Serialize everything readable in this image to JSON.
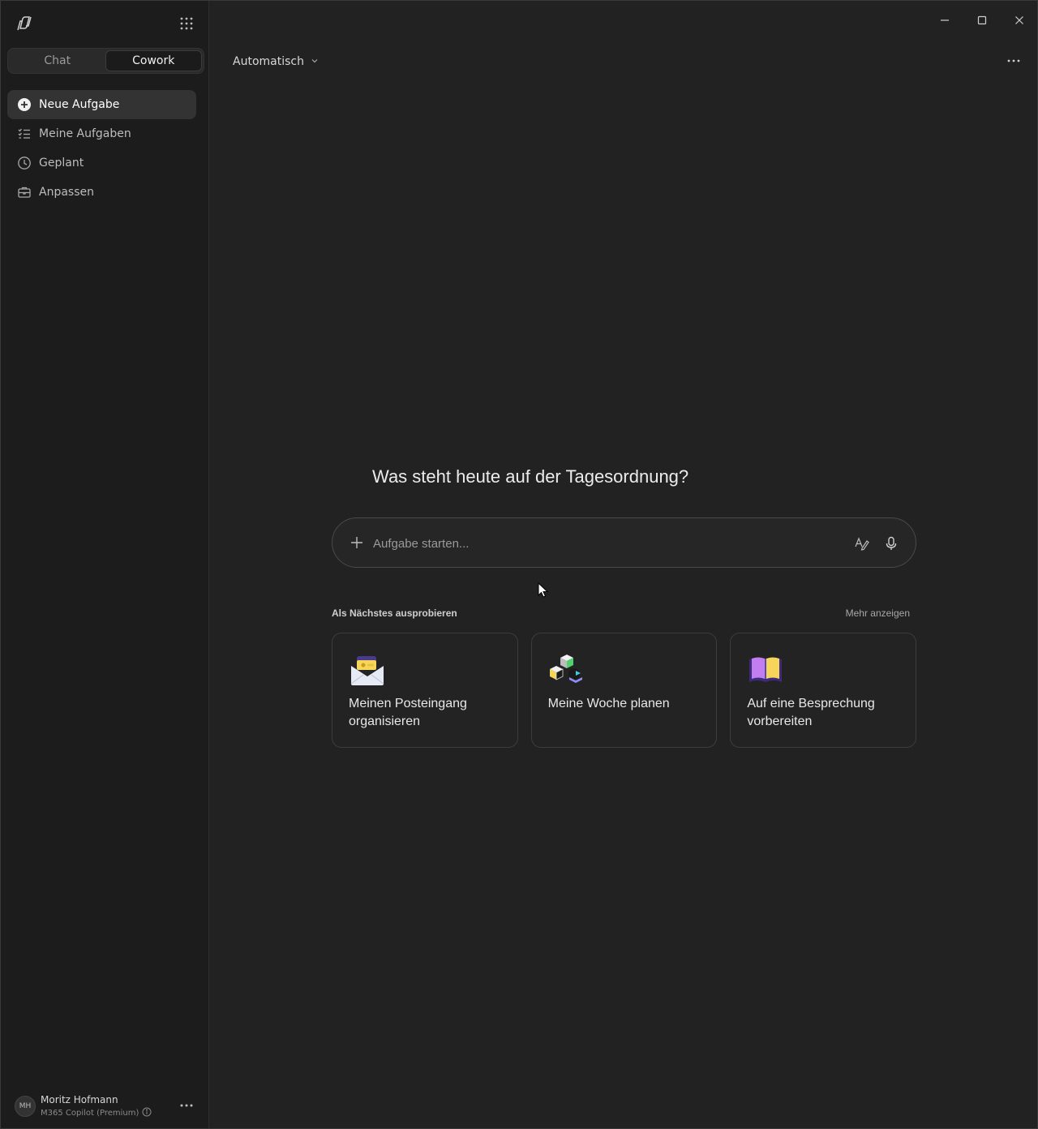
{
  "sidebar": {
    "modes": [
      {
        "label": "Chat",
        "active": false
      },
      {
        "label": "Cowork",
        "active": true
      }
    ],
    "nav": [
      {
        "label": "Neue Aufgabe",
        "icon": "plus-circle-icon",
        "active": true
      },
      {
        "label": "Meine Aufgaben",
        "icon": "task-list-icon",
        "active": false
      },
      {
        "label": "Geplant",
        "icon": "clock-icon",
        "active": false
      },
      {
        "label": "Anpassen",
        "icon": "briefcase-icon",
        "active": false
      }
    ],
    "user": {
      "initials": "MH",
      "name": "Moritz Hofmann",
      "plan": "M365 Copilot (Premium)"
    }
  },
  "header": {
    "model": "Automatisch"
  },
  "main": {
    "headline": "Was steht heute auf der Tagesordnung?",
    "composer": {
      "placeholder": "Aufgabe starten..."
    },
    "suggestions": {
      "label": "Als Nächstes ausprobieren",
      "more": "Mehr anzeigen",
      "cards": [
        {
          "text": "Meinen Posteingang organisieren",
          "icon": "envelope-icon"
        },
        {
          "text": "Meine Woche planen",
          "icon": "cubes-icon"
        },
        {
          "text": "Auf eine Besprechung vorbereiten",
          "icon": "book-icon"
        }
      ]
    }
  }
}
